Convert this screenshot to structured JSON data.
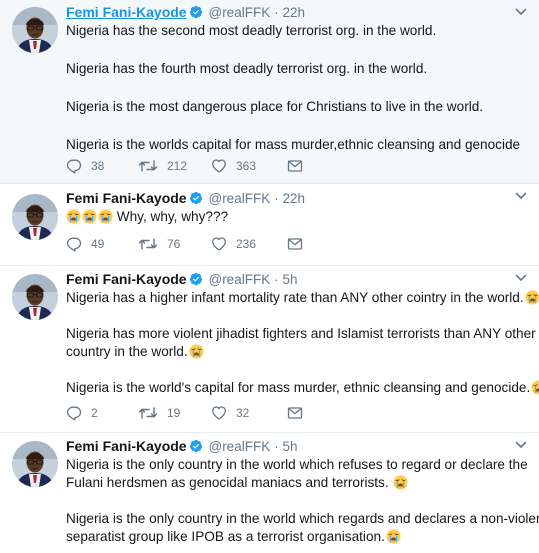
{
  "colors": {
    "name_link": "#1b95e0",
    "verified": "#1da1f2",
    "muted": "#657786"
  },
  "tweets": [
    {
      "name": "Femi Fani-Kayode",
      "handle": "@realFFK",
      "time": "22h",
      "lines": [
        "Nigeria has the second most deadly terrorist org. in the world.",
        "Nigeria has the fourth most deadly terrorist org. in the world.",
        "Nigeria is the most dangerous place for Christians to live in the world.",
        "Nigeria is the worlds capital for mass murder,ethnic cleansing and genocide"
      ],
      "replies": "38",
      "retweets": "212",
      "likes": "363"
    },
    {
      "name": "Femi Fani-Kayode",
      "handle": "@realFFK",
      "time": "22h",
      "lines": [
        "Why, why, why???"
      ],
      "replies": "49",
      "retweets": "76",
      "likes": "236"
    },
    {
      "name": "Femi Fani-Kayode",
      "handle": "@realFFK",
      "time": "5h",
      "lines": [
        "Nigeria has a higher infant mortality rate than ANY other cointry in the world.",
        "Nigeria has more violent jihadist fighters and Islamist terrorists than ANY other",
        "country in the world.",
        "Nigeria is the world's capital for mass murder, ethnic cleansing and genocide."
      ],
      "replies": "2",
      "retweets": "19",
      "likes": "32"
    },
    {
      "name": "Femi Fani-Kayode",
      "handle": "@realFFK",
      "time": "5h",
      "lines": [
        "Nigeria is the only country in the world which refuses to regard or declare the",
        "Fulani herdsmen as genocidal maniacs and terrorists.",
        "Nigeria is the only country in the world which regards and declares a non-violent",
        "separatist group like IPOB as a terrorist organisation."
      ]
    }
  ],
  "icons": [
    "avatar",
    "verified-icon",
    "caret-down-icon",
    "crying-face-emoji",
    "reply-icon",
    "retweet-icon",
    "like-icon",
    "message-icon"
  ]
}
